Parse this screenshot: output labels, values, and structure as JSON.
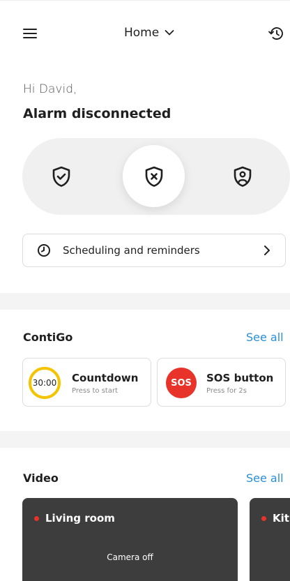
{
  "header": {
    "location_label": "Home",
    "icons": [
      "menu-icon",
      "chevron-down-icon",
      "history-icon"
    ]
  },
  "greeting": "Hi David,",
  "alarm_status": "Alarm disconnected",
  "modes": {
    "icons": [
      "shield-check-icon",
      "shield-x-icon",
      "shield-person-icon"
    ],
    "active": "shield-x-icon"
  },
  "scheduling": {
    "label": "Scheduling and reminders",
    "icons": [
      "clock-icon",
      "chevron-right-icon"
    ]
  },
  "contigo": {
    "title": "ContiGo",
    "see_all": "See all",
    "countdown": {
      "timer": "30:00",
      "title": "Countdown",
      "subtitle": "Press to start"
    },
    "sos": {
      "badge": "SOS",
      "title": "SOS button",
      "subtitle": "Press for 2s"
    }
  },
  "video": {
    "title": "Video",
    "see_all": "See all",
    "cameras": [
      {
        "name": "Living room",
        "status": "Camera off"
      },
      {
        "name": "Kit",
        "status": ""
      }
    ]
  },
  "colors": {
    "accent_link": "#2a8fd6",
    "sos_red": "#e8332a",
    "countdown_yellow": "#f5c400",
    "video_card_bg": "#3d3d3d",
    "pill_bg": "#f0f0f0",
    "divider_bg": "#f4f4f4"
  }
}
